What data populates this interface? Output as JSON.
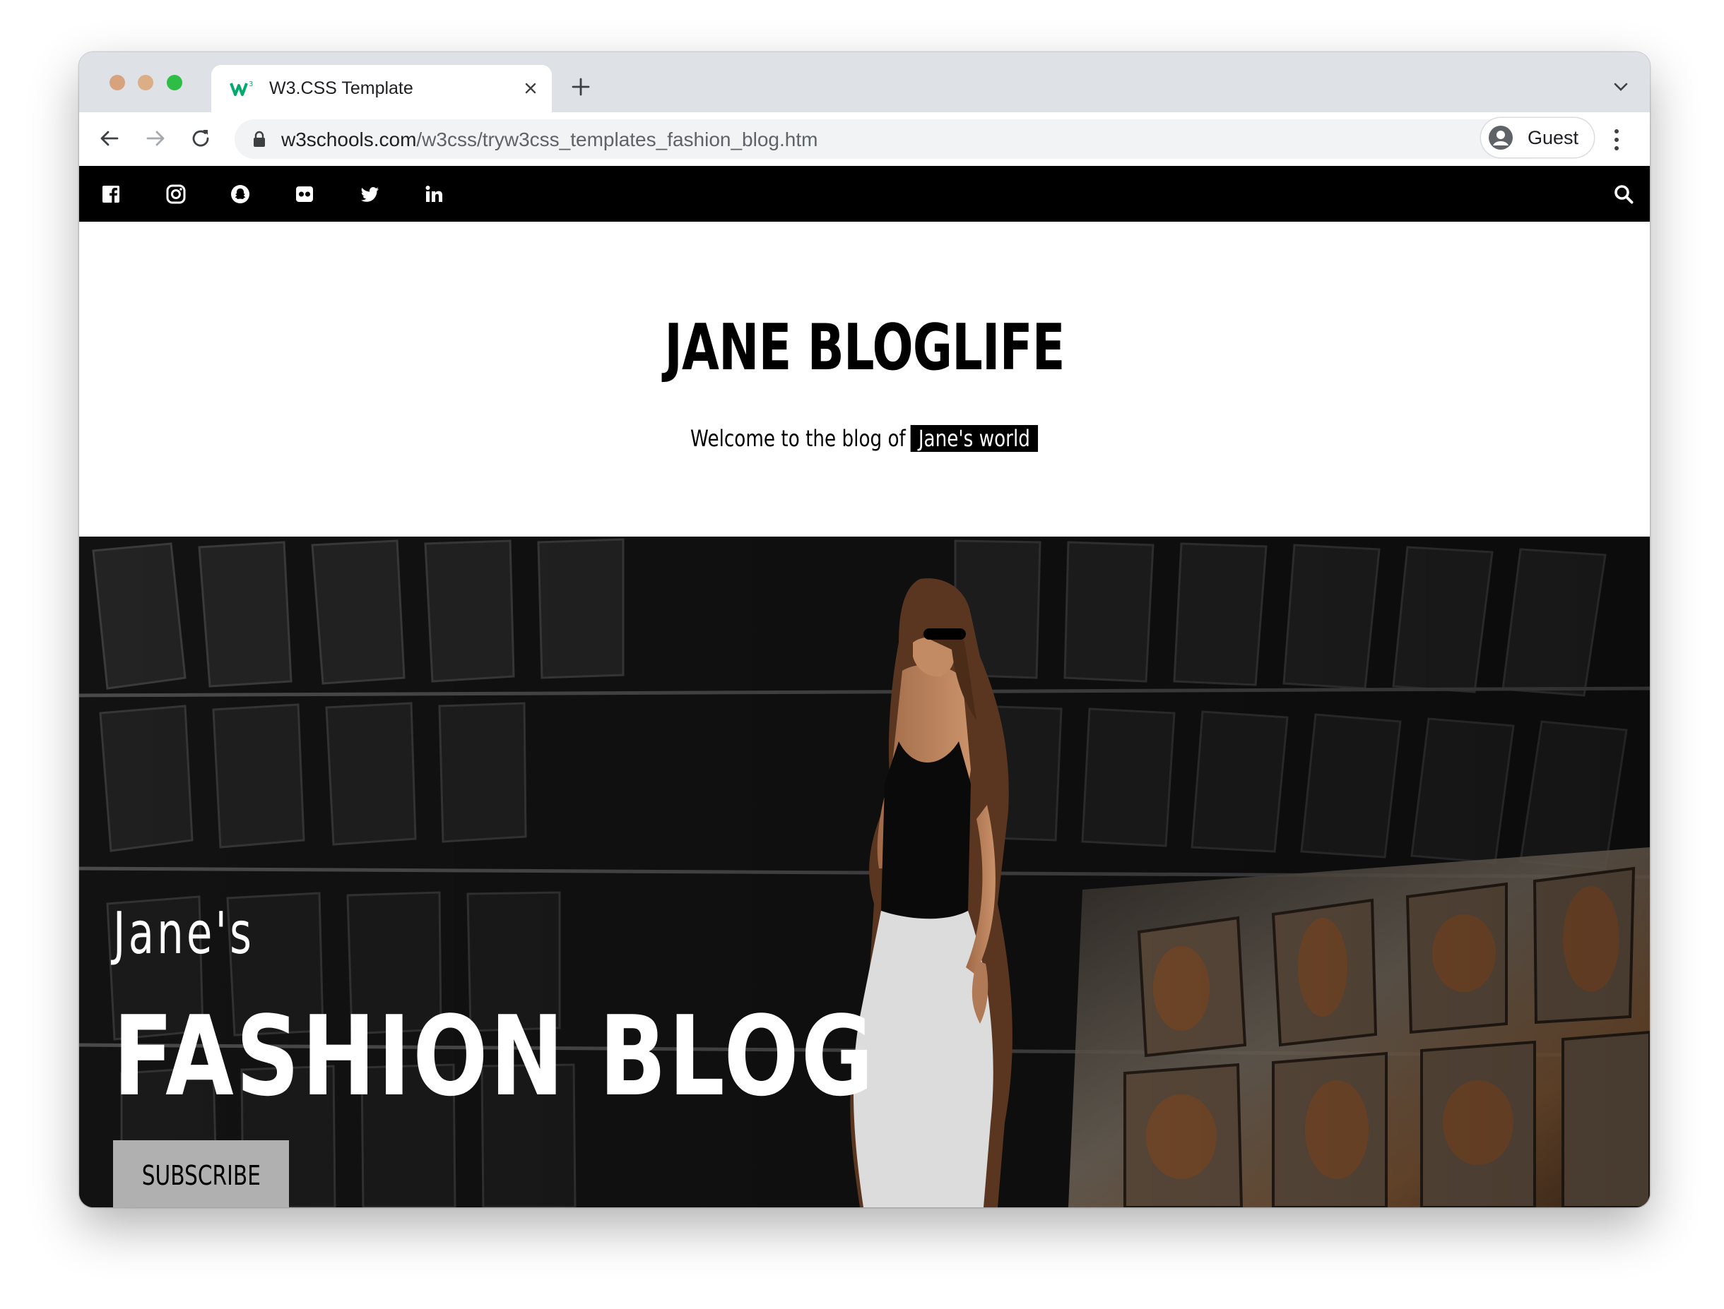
{
  "browser": {
    "tab_title": "W3.CSS Template",
    "url_domain": "w3schools.com",
    "url_path": "/w3css/tryw3css_templates_fashion_blog.htm",
    "profile_label": "Guest",
    "favicon_color": "#04aa6d"
  },
  "social_bar": {
    "icons": [
      "facebook-icon",
      "instagram-icon",
      "snapchat-icon",
      "flickr-icon",
      "twitter-icon",
      "linkedin-icon"
    ],
    "search_icon": "search-icon"
  },
  "header": {
    "title": "JANE BLOGLIFE",
    "tagline_prefix": "Welcome to the blog of",
    "tagline_highlight": "Jane's world"
  },
  "hero": {
    "subtitle": "Jane's",
    "title": "FASHION BLOG",
    "button_label": "SUBSCRIBE"
  }
}
